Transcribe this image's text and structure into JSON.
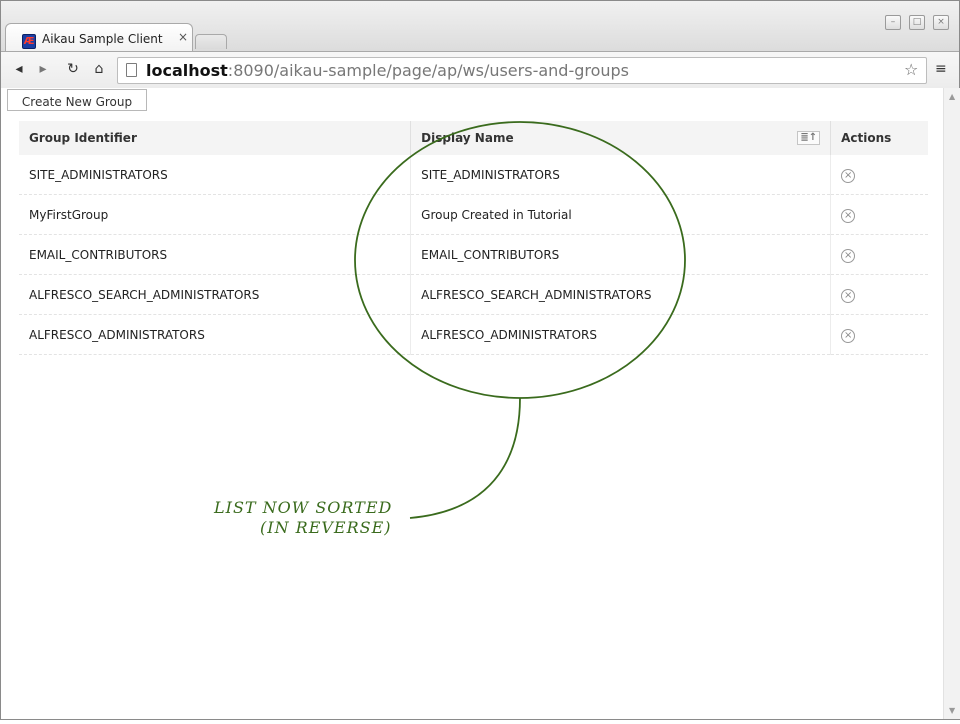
{
  "browser": {
    "tab_title": "Aikau Sample Client",
    "tab_close": "×",
    "favicon_letter": "Æ",
    "url_host": "localhost",
    "url_rest": ":8090/aikau-sample/page/ap/ws/users-and-groups",
    "back_icon": "◂",
    "forward_icon": "▸",
    "reload_icon": "↻",
    "home_icon": "⌂",
    "star_icon": "☆",
    "menu_icon": "≡",
    "minimize_icon": "–",
    "maximize_icon": "□",
    "close_icon": "×"
  },
  "page": {
    "create_button": "Create New Group",
    "columns": {
      "group_identifier": "Group Identifier",
      "display_name": "Display Name",
      "actions": "Actions"
    },
    "sort_icon": "≣↑",
    "delete_icon": "×",
    "rows": [
      {
        "id": "SITE_ADMINISTRATORS",
        "name": "SITE_ADMINISTRATORS"
      },
      {
        "id": "MyFirstGroup",
        "name": "Group Created in Tutorial"
      },
      {
        "id": "EMAIL_CONTRIBUTORS",
        "name": "EMAIL_CONTRIBUTORS"
      },
      {
        "id": "ALFRESCO_SEARCH_ADMINISTRATORS",
        "name": "ALFRESCO_SEARCH_ADMINISTRATORS"
      },
      {
        "id": "ALFRESCO_ADMINISTRATORS",
        "name": "ALFRESCO_ADMINISTRATORS"
      }
    ]
  },
  "annotation": {
    "line1": "LIST NOW SORTED",
    "line2": "(IN REVERSE)",
    "color": "#3a6b1d"
  }
}
